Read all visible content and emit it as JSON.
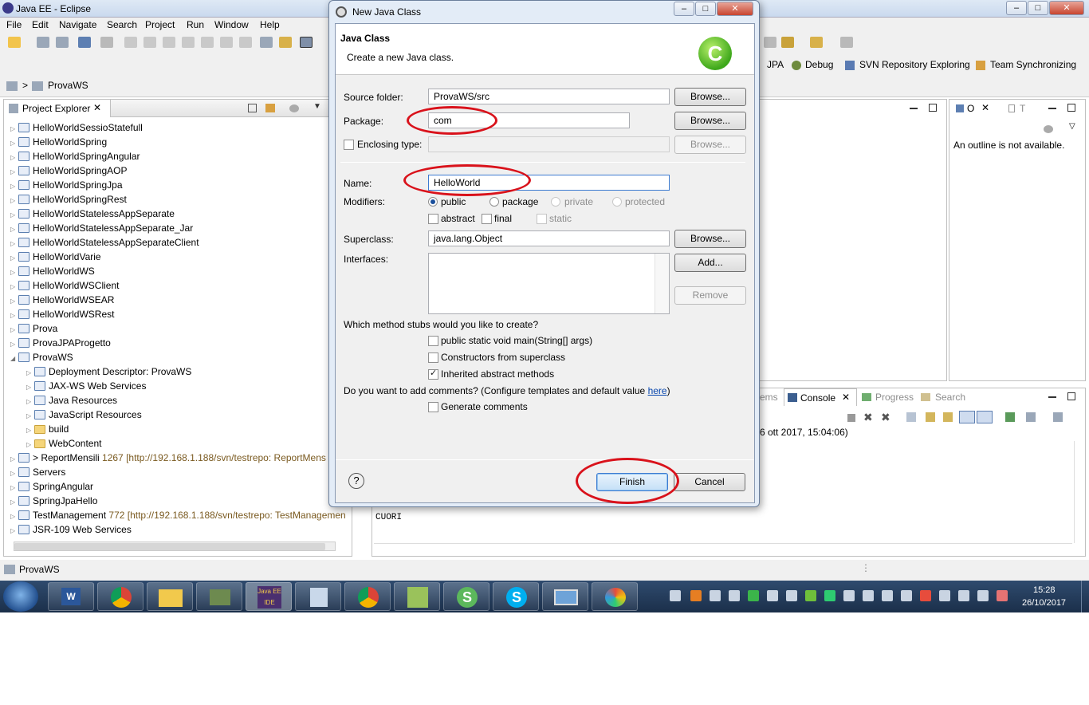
{
  "window": {
    "title": "Java EE - Eclipse"
  },
  "menu": [
    "File",
    "Edit",
    "Navigate",
    "Search",
    "Project",
    "Run",
    "Window",
    "Help"
  ],
  "perspectives": {
    "jpa": "JPA",
    "debug": "Debug",
    "svn": "SVN Repository Exploring",
    "team": "Team Synchronizing"
  },
  "breadcrumb": "ProvaWS",
  "explorer": {
    "title": "Project Explorer",
    "items": [
      "HelloWorldSessioStatefull",
      "HelloWorldSpring",
      "HelloWorldSpringAngular",
      "HelloWorldSpringAOP",
      "HelloWorldSpringJpa",
      "HelloWorldSpringRest",
      "HelloWorldStatelessAppSeparate",
      "HelloWorldStatelessAppSeparate_Jar",
      "HelloWorldStatelessAppSeparateClient",
      "HelloWorldVarie",
      "HelloWorldWS",
      "HelloWorldWSClient",
      "HelloWorldWSEAR",
      "HelloWorldWSRest",
      "Prova",
      "ProvaJPAProgetto",
      "ProvaWS"
    ],
    "children": [
      "Deployment Descriptor: ProvaWS",
      "JAX-WS Web Services",
      "Java Resources",
      "JavaScript Resources",
      "build",
      "WebContent"
    ],
    "after": [
      {
        "prefix": "> ",
        "label": "ReportMensili",
        "svn": " 1267 [http://192.168.1.188/svn/testrepo: ReportMens"
      },
      {
        "prefix": "",
        "label": "Servers",
        "svn": ""
      },
      {
        "prefix": "",
        "label": "SpringAngular",
        "svn": ""
      },
      {
        "prefix": "",
        "label": "SpringJpaHello",
        "svn": ""
      },
      {
        "prefix": "",
        "label": "TestManagement",
        "svn": " 772 [http://192.168.1.188/svn/testrepo: TestManagemen"
      },
      {
        "prefix": "",
        "label": "JSR-109 Web Services",
        "svn": ""
      }
    ]
  },
  "outline": {
    "tab1": "O",
    "tab2": "T",
    "message": "An outline is not available."
  },
  "console": {
    "tab_problems": "ems",
    "tab_console": "Console",
    "tab_progress": "Progress",
    "tab_search": "Search",
    "timestamp": "6 ott 2017, 15:04:06)",
    "output": "CUORI"
  },
  "status": {
    "label": "ProvaWS"
  },
  "taskbar": {
    "time": "15:28",
    "date": "26/10/2017"
  },
  "dialog": {
    "title": "New Java Class",
    "header_title": "Java Class",
    "header_desc": "Create a new Java class.",
    "source_folder_label": "Source folder:",
    "source_folder_value": "ProvaWS/src",
    "package_label": "Package:",
    "package_value": "com",
    "enclosing_label": "Enclosing type:",
    "enclosing_value": "",
    "browse": "Browse...",
    "name_label": "Name:",
    "name_value": "HelloWorld",
    "modifiers_label": "Modifiers:",
    "mod_public": "public",
    "mod_package": "package",
    "mod_private": "private",
    "mod_protected": "protected",
    "mod_abstract": "abstract",
    "mod_final": "final",
    "mod_static": "static",
    "superclass_label": "Superclass:",
    "superclass_value": "java.lang.Object",
    "interfaces_label": "Interfaces:",
    "add": "Add...",
    "remove": "Remove",
    "stubs_question": "Which method stubs would you like to create?",
    "stub_main": "public static void main(String[] args)",
    "stub_constructors": "Constructors from superclass",
    "stub_inherited": "Inherited abstract methods",
    "comments_question": "Do you want to add comments? (Configure templates and default value ",
    "comments_link": "here",
    "comments_close": ")",
    "generate_comments": "Generate comments",
    "finish": "Finish",
    "cancel": "Cancel",
    "help": "?"
  },
  "colors": {
    "annotation_ring": "#d9121b",
    "link": "#0645ad",
    "taskbar": "#1b2f4a"
  }
}
